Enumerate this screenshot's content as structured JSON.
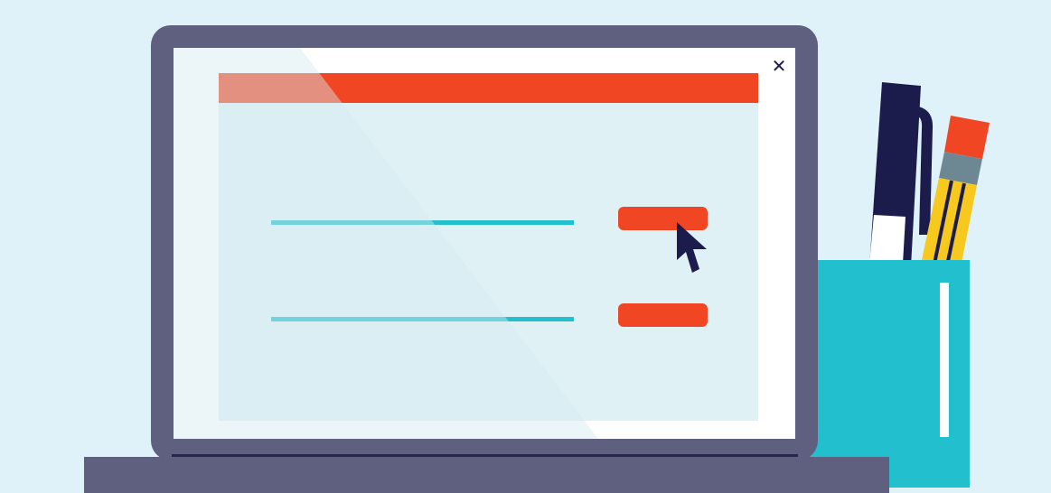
{
  "colors": {
    "background": "#dff2f9",
    "laptop_frame": "#5f5f80",
    "screen": "#ffffff",
    "window_body": "#e0f1f5",
    "accent": "#f04623",
    "line": "#22bfcf",
    "cursor": "#1b1c4c",
    "cup": "#22bfcf",
    "pen": "#1b1c4c",
    "pencil": "#f7c81e",
    "pencil_band": "#6e8893"
  },
  "icons": {
    "close": "close-icon",
    "cursor": "mouse-pointer-icon"
  },
  "screen": {
    "close_label": "✕"
  },
  "dialog": {
    "rows": [
      {
        "name": "row-1"
      },
      {
        "name": "row-2"
      }
    ]
  }
}
